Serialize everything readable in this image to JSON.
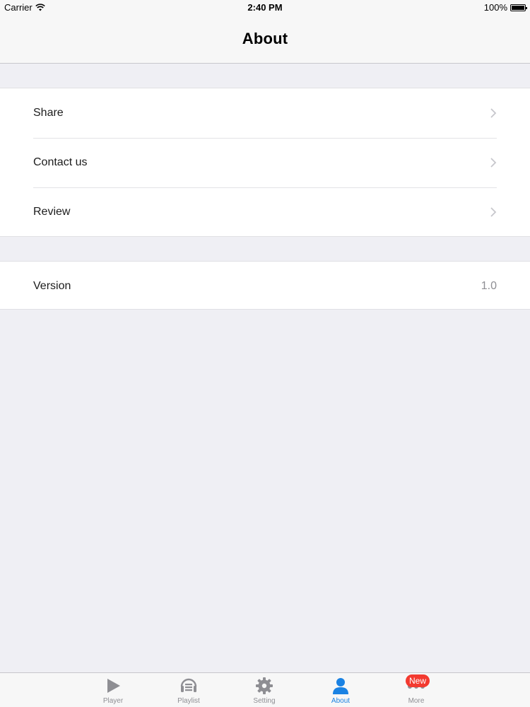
{
  "status_bar": {
    "carrier": "Carrier",
    "time": "2:40 PM",
    "battery": "100%"
  },
  "nav": {
    "title": "About"
  },
  "group1": {
    "items": [
      {
        "label": "Share"
      },
      {
        "label": "Contact us"
      },
      {
        "label": "Review"
      }
    ]
  },
  "group2": {
    "version_label": "Version",
    "version_value": "1.0"
  },
  "tabs": [
    {
      "label": "Player",
      "icon": "play-icon"
    },
    {
      "label": "Playlist",
      "icon": "playlist-icon"
    },
    {
      "label": "Setting",
      "icon": "gear-icon"
    },
    {
      "label": "About",
      "icon": "person-icon",
      "active": true
    },
    {
      "label": "More",
      "icon": "more-icon",
      "badge": "New"
    }
  ],
  "colors": {
    "accent": "#1a82e3",
    "badge": "#f33a30",
    "background": "#efeff4"
  }
}
